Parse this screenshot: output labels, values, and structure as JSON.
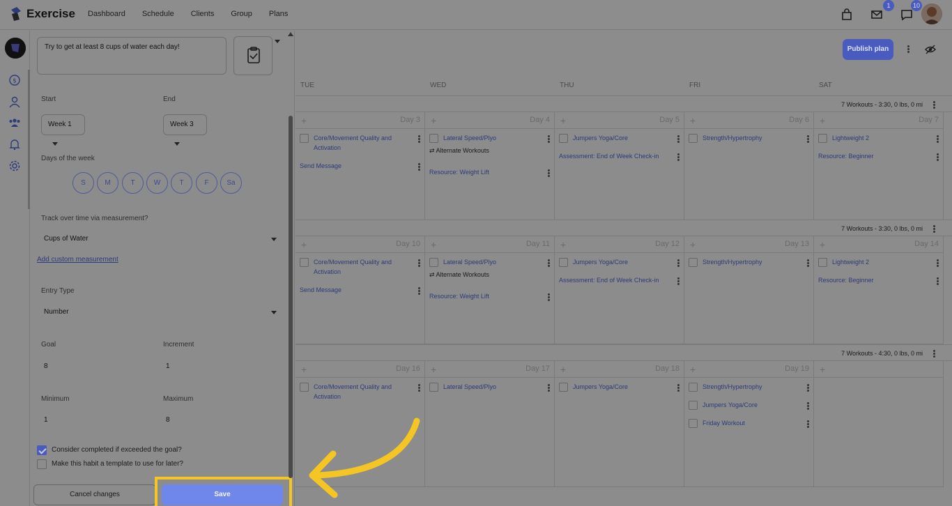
{
  "app": {
    "name": "Exercise",
    "nav": [
      "Dashboard",
      "Schedule",
      "Clients",
      "Group",
      "Plans"
    ],
    "mail_badge": "1",
    "chat_badge": "10"
  },
  "rail": {
    "icons": [
      "dollar-icon",
      "user-icon",
      "group-icon",
      "bell-icon",
      "gear-icon"
    ]
  },
  "form": {
    "habit_text": "Try to get at least 8 cups of water each day!",
    "start_label": "Start",
    "end_label": "End",
    "start_value": "Week 1",
    "end_value": "Week 3",
    "days_label": "Days of the week",
    "days": [
      "S",
      "M",
      "T",
      "W",
      "T",
      "F",
      "Sa"
    ],
    "track_label": "Track over time via measurement?",
    "measurement": "Cups of Water",
    "add_custom": "Add custom measurement",
    "entry_type_label": "Entry Type",
    "entry_type": "Number",
    "goal_label": "Goal",
    "goal": "8",
    "increment_label": "Increment",
    "increment": "1",
    "minimum_label": "Minimum",
    "minimum": "1",
    "maximum_label": "Maximum",
    "maximum": "8",
    "exceeded_label": "Consider completed if exceeded the goal?",
    "exceeded_checked": true,
    "template_label": "Make this habit a template to use for later?",
    "template_checked": false,
    "cancel": "Cancel changes",
    "save": "Save"
  },
  "calendar": {
    "publish": "Publish plan",
    "days_of_week": [
      "TUE",
      "WED",
      "THU",
      "FRI",
      "SAT"
    ],
    "weeks": [
      {
        "summary": "7 Workouts - 3:30, 0 lbs, 0 mi",
        "days": [
          {
            "num": "Day 3",
            "items": [
              {
                "t": "Core/Movement Quality and Activation",
                "k": "w"
              },
              {
                "t": "Send Message",
                "k": "r"
              }
            ]
          },
          {
            "num": "Day 4",
            "items": [
              {
                "t": "Lateral Speed/Plyo",
                "k": "w",
                "alt": "Alternate Workouts"
              },
              {
                "t": "Resource: Weight Lift",
                "k": "r"
              }
            ]
          },
          {
            "num": "Day 5",
            "items": [
              {
                "t": "Jumpers Yoga/Core",
                "k": "w"
              },
              {
                "t": "Assessment: End of Week Check-in",
                "k": "r"
              }
            ]
          },
          {
            "num": "Day 6",
            "items": [
              {
                "t": "Strength/Hypertrophy",
                "k": "w"
              }
            ]
          },
          {
            "num": "Day 7",
            "items": [
              {
                "t": "Lightweight 2",
                "k": "w"
              },
              {
                "t": "Resource: Beginner",
                "k": "r"
              }
            ]
          }
        ]
      },
      {
        "summary": "7 Workouts - 3:30, 0 lbs, 0 mi",
        "days": [
          {
            "num": "Day 10",
            "items": [
              {
                "t": "Core/Movement Quality and Activation",
                "k": "w"
              },
              {
                "t": "Send Message",
                "k": "r"
              }
            ]
          },
          {
            "num": "Day 11",
            "items": [
              {
                "t": "Lateral Speed/Plyo",
                "k": "w",
                "alt": "Alternate Workouts"
              },
              {
                "t": "Resource: Weight Lift",
                "k": "r"
              }
            ]
          },
          {
            "num": "Day 12",
            "items": [
              {
                "t": "Jumpers Yoga/Core",
                "k": "w"
              },
              {
                "t": "Assessment: End of Week Check-in",
                "k": "r"
              }
            ]
          },
          {
            "num": "Day 13",
            "items": [
              {
                "t": "Strength/Hypertrophy",
                "k": "w"
              }
            ]
          },
          {
            "num": "Day 14",
            "items": [
              {
                "t": "Lightweight 2",
                "k": "w"
              },
              {
                "t": "Resource: Beginner",
                "k": "r"
              }
            ]
          }
        ]
      },
      {
        "summary": "7 Workouts - 4:30, 0 lbs, 0 mi",
        "days": [
          {
            "num": "Day 16",
            "items": [
              {
                "t": "Core/Movement Quality and Activation",
                "k": "w"
              }
            ]
          },
          {
            "num": "Day 17",
            "items": [
              {
                "t": "Lateral Speed/Plyo",
                "k": "w"
              }
            ]
          },
          {
            "num": "Day 18",
            "items": [
              {
                "t": "Jumpers Yoga/Core",
                "k": "w"
              }
            ]
          },
          {
            "num": "Day 19",
            "items": [
              {
                "t": "Strength/Hypertrophy",
                "k": "w"
              },
              {
                "t": "Jumpers Yoga/Core",
                "k": "w"
              },
              {
                "t": "Friday Workout",
                "k": "w"
              }
            ]
          },
          {
            "num": "",
            "items": []
          }
        ]
      }
    ]
  },
  "colors": {
    "accent": "#4a5bbf",
    "save_button": "#6f86eb",
    "highlight": "#f5c623"
  }
}
